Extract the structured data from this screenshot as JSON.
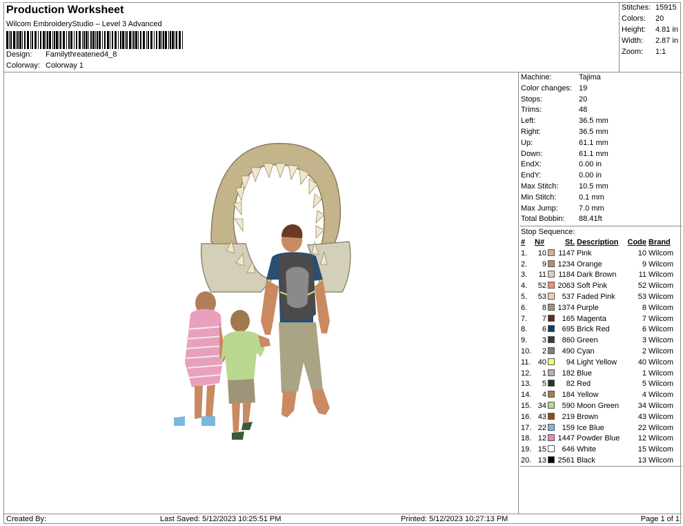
{
  "header": {
    "title": "Production Worksheet",
    "subtitle": "Wilcom EmbroideryStudio – Level 3 Advanced",
    "design_label": "Design:",
    "design_value": "Familythreatened4_8",
    "colorway_label": "Colorway:",
    "colorway_value": "Colorway 1"
  },
  "stats": {
    "stitches_label": "Stitches:",
    "stitches": "15915",
    "colors_label": "Colors:",
    "colors": "20",
    "height_label": "Height:",
    "height": "4.81 in",
    "width_label": "Width:",
    "width": "2.87 in",
    "zoom_label": "Zoom:",
    "zoom": "1:1"
  },
  "machine_info": [
    {
      "label": "Machine:",
      "value": "Tajima"
    },
    {
      "label": "Color changes:",
      "value": "19"
    },
    {
      "label": "Stops:",
      "value": "20"
    },
    {
      "label": "Trims:",
      "value": "48"
    },
    {
      "label": "Left:",
      "value": "36.5 mm"
    },
    {
      "label": "Right:",
      "value": "36.5 mm"
    },
    {
      "label": "Up:",
      "value": "61.1 mm"
    },
    {
      "label": "Down:",
      "value": "61.1 mm"
    },
    {
      "label": "EndX:",
      "value": "0.00 in"
    },
    {
      "label": "EndY:",
      "value": "0.00 in"
    },
    {
      "label": "Max Stitch:",
      "value": "10.5 mm"
    },
    {
      "label": "Min Stitch:",
      "value": "0.1 mm"
    },
    {
      "label": "Max Jump:",
      "value": "7.0 mm"
    },
    {
      "label": "Total Bobbin:",
      "value": "88.41ft"
    }
  ],
  "stop_sequence": {
    "title": "Stop Sequence:",
    "headers": {
      "no": "#",
      "n": "N#",
      "st": "St.",
      "desc": "Description",
      "code": "Code",
      "brand": "Brand"
    },
    "rows": [
      {
        "no": "1.",
        "n": "10",
        "color": "#c8b496",
        "st": "1147",
        "desc": "Pink",
        "code": "10",
        "brand": "Wilcom"
      },
      {
        "no": "2.",
        "n": "9",
        "color": "#b09070",
        "st": "1234",
        "desc": "Orange",
        "code": "9",
        "brand": "Wilcom"
      },
      {
        "no": "3.",
        "n": "11",
        "color": "#d8cfc0",
        "st": "1184",
        "desc": "Dark Brown",
        "code": "11",
        "brand": "Wilcom"
      },
      {
        "no": "4.",
        "n": "52",
        "color": "#f0907a",
        "st": "2063",
        "desc": "Soft Pink",
        "code": "52",
        "brand": "Wilcom"
      },
      {
        "no": "5.",
        "n": "53",
        "color": "#f8c8b8",
        "st": "537",
        "desc": "Faded Pink",
        "code": "53",
        "brand": "Wilcom"
      },
      {
        "no": "6.",
        "n": "8",
        "color": "#a09480",
        "st": "1374",
        "desc": "Purple",
        "code": "8",
        "brand": "Wilcom"
      },
      {
        "no": "7.",
        "n": "7",
        "color": "#5a3020",
        "st": "165",
        "desc": "Magenta",
        "code": "7",
        "brand": "Wilcom"
      },
      {
        "no": "8.",
        "n": "6",
        "color": "#183a60",
        "st": "695",
        "desc": "Brick Red",
        "code": "6",
        "brand": "Wilcom"
      },
      {
        "no": "9.",
        "n": "3",
        "color": "#3a3a3a",
        "st": "860",
        "desc": "Green",
        "code": "3",
        "brand": "Wilcom"
      },
      {
        "no": "10.",
        "n": "2",
        "color": "#808080",
        "st": "490",
        "desc": "Cyan",
        "code": "2",
        "brand": "Wilcom"
      },
      {
        "no": "11.",
        "n": "40",
        "color": "#f8f870",
        "st": "94",
        "desc": "Light Yellow",
        "code": "40",
        "brand": "Wilcom"
      },
      {
        "no": "12.",
        "n": "1",
        "color": "#b0b0b0",
        "st": "182",
        "desc": "Blue",
        "code": "1",
        "brand": "Wilcom"
      },
      {
        "no": "13.",
        "n": "5",
        "color": "#1a3a2a",
        "st": "82",
        "desc": "Red",
        "code": "5",
        "brand": "Wilcom"
      },
      {
        "no": "14.",
        "n": "4",
        "color": "#b07848",
        "st": "184",
        "desc": "Yellow",
        "code": "4",
        "brand": "Wilcom"
      },
      {
        "no": "15.",
        "n": "34",
        "color": "#b8d890",
        "st": "590",
        "desc": "Moon Green",
        "code": "34",
        "brand": "Wilcom"
      },
      {
        "no": "16.",
        "n": "43",
        "color": "#8a5020",
        "st": "219",
        "desc": "Brown",
        "code": "43",
        "brand": "Wilcom"
      },
      {
        "no": "17.",
        "n": "22",
        "color": "#78b8e8",
        "st": "159",
        "desc": "Ice Blue",
        "code": "22",
        "brand": "Wilcom"
      },
      {
        "no": "18.",
        "n": "12",
        "color": "#e888c0",
        "st": "1447",
        "desc": "Powder Blue",
        "code": "12",
        "brand": "Wilcom"
      },
      {
        "no": "19.",
        "n": "15",
        "color": "#ffffff",
        "st": "646",
        "desc": "White",
        "code": "15",
        "brand": "Wilcom"
      },
      {
        "no": "20.",
        "n": "13",
        "color": "#000000",
        "st": "2561",
        "desc": "Black",
        "code": "13",
        "brand": "Wilcom"
      }
    ]
  },
  "footer": {
    "created": "Created By:",
    "last_saved": "Last Saved: 5/12/2023 10:25:51 PM",
    "printed": "Printed: 5/12/2023 10:27:13 PM",
    "page": "Page 1 of 1"
  },
  "artwork_colors": {
    "jaw": "#c4b48c",
    "jaw_dark": "#8a7a58",
    "jaw_lower": "#d4cfb8",
    "teeth": "#efe8cc",
    "skin": "#c98a62",
    "hair_girl": "#b07e5a",
    "hair_boy": "#a0784e",
    "hair_man": "#6a3a22",
    "dress_pink": "#e9a0bc",
    "dress_white": "#f4e8ee",
    "shirt_green": "#b8d890",
    "shorts": "#9e9478",
    "shirt_blue": "#2a4e74",
    "backpack": "#4a4a4a",
    "backpack_light": "#8a8a8a",
    "pants": "#a8a484",
    "shoe_blue": "#7ab8e0",
    "shoe_green": "#3a5a3a",
    "accent_yellow": "#e8e860"
  }
}
